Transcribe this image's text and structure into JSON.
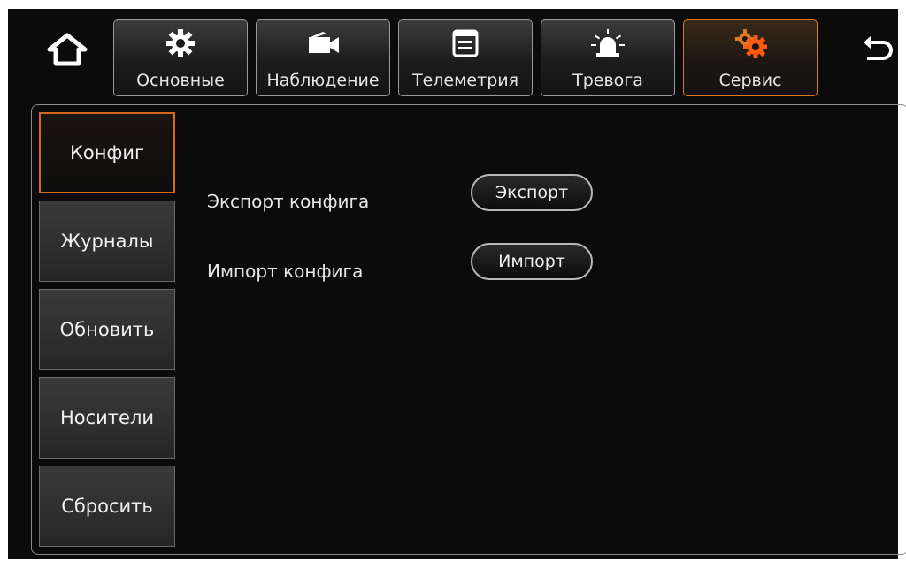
{
  "tabs": [
    {
      "label": "Основные",
      "icon": "gear-icon"
    },
    {
      "label": "Наблюдение",
      "icon": "video-camera-icon"
    },
    {
      "label": "Телеметрия",
      "icon": "document-window-icon"
    },
    {
      "label": "Тревога",
      "icon": "alarm-light-icon"
    },
    {
      "label": "Сервис",
      "icon": "service-gears-icon"
    }
  ],
  "active_tab": "Сервис",
  "sidebar": {
    "items": [
      {
        "label": "Конфиг"
      },
      {
        "label": "Журналы"
      },
      {
        "label": "Обновить"
      },
      {
        "label": "Носители"
      },
      {
        "label": "Сбросить"
      }
    ],
    "active": "Конфиг"
  },
  "config": {
    "export_label": "Экспорт конфига",
    "export_button": "Экспорт",
    "import_label": "Импорт конфига",
    "import_button": "Импорт"
  },
  "colors": {
    "accent": "#e07a1c",
    "background": "#0b0b0b",
    "text": "#f0f0f0"
  }
}
